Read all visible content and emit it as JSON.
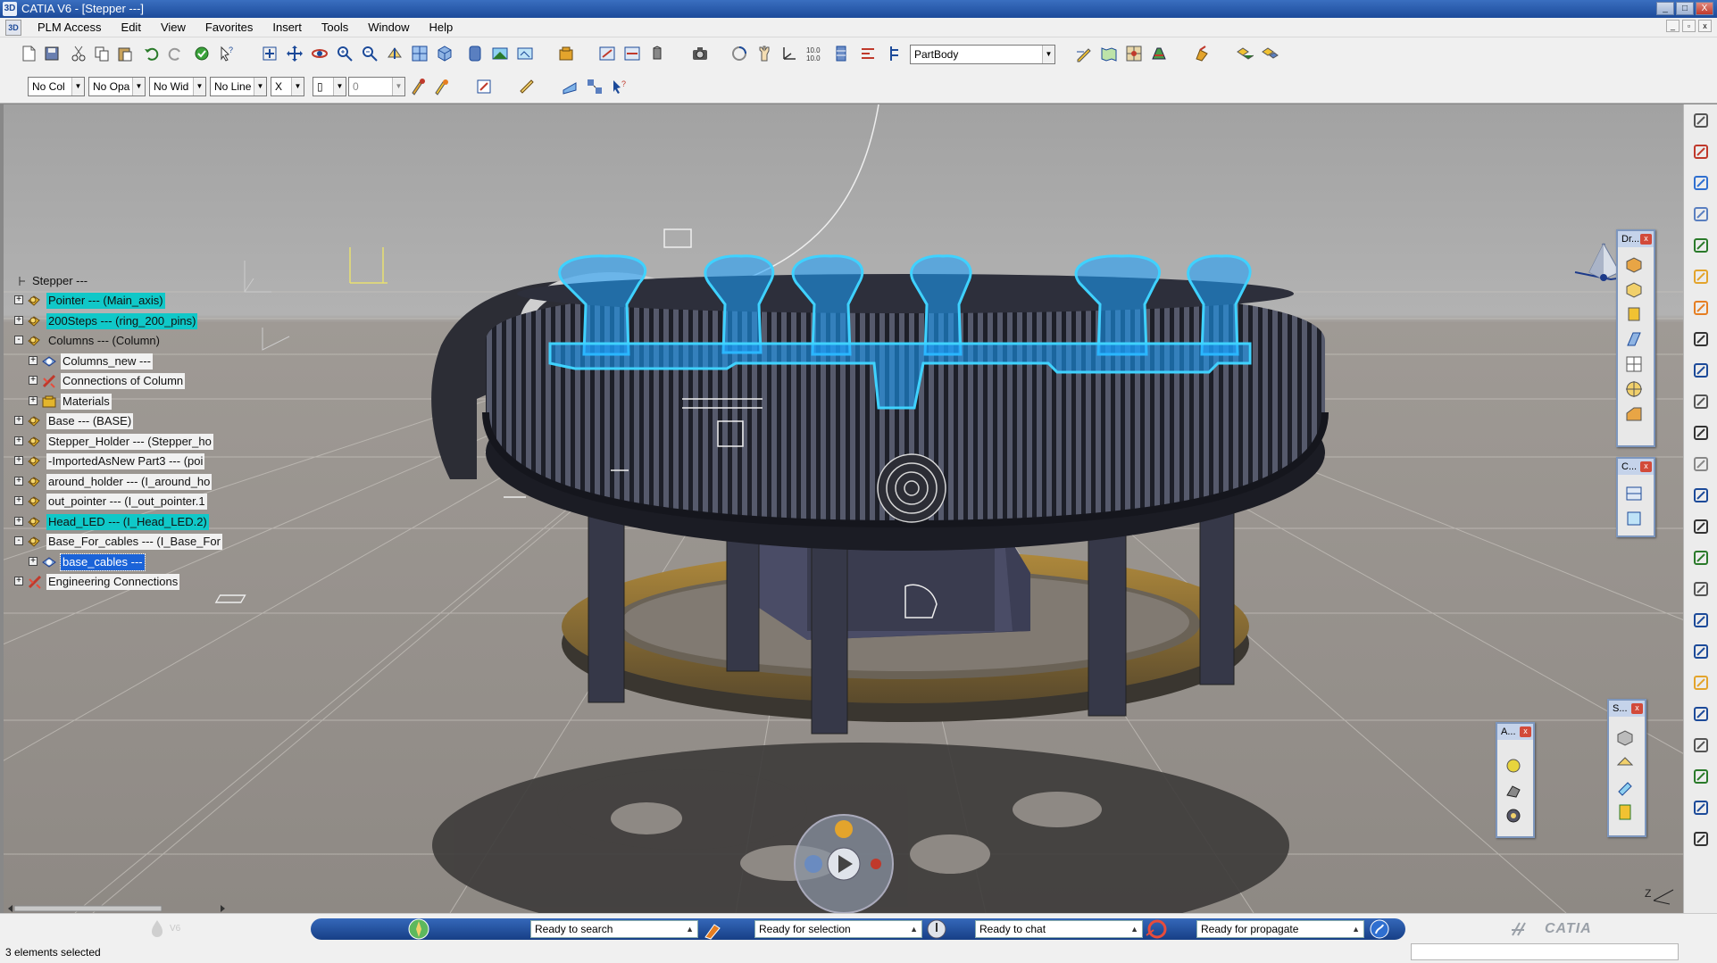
{
  "window": {
    "title": "CATIA V6 - [Stepper ---]",
    "buttons": [
      "_",
      "□",
      "X"
    ]
  },
  "menu": {
    "items": [
      "PLM Access",
      "Edit",
      "View",
      "Favorites",
      "Insert",
      "Tools",
      "Window",
      "Help"
    ]
  },
  "toolbar": {
    "body_select": "PartBody"
  },
  "graphic_props": {
    "color": "No Col",
    "opacity": "No Opa",
    "width": "No Wid",
    "line": "No Line",
    "point": "X",
    "layer_value": "0"
  },
  "tree": {
    "root": "Stepper ---",
    "nodes": [
      {
        "label": "Pointer --- (Main_axis)",
        "state": "highlight"
      },
      {
        "label": "200Steps --- (ring_200_pins)",
        "state": "highlight"
      },
      {
        "label": "Columns --- (Column)",
        "state": "plain"
      },
      {
        "label": "Columns_new ---",
        "state": "normal"
      },
      {
        "label": "Connections of Column",
        "state": "normal"
      },
      {
        "label": "Materials",
        "state": "normal"
      },
      {
        "label": "Base --- (BASE)",
        "state": "normal"
      },
      {
        "label": "Stepper_Holder --- (Stepper_ho",
        "state": "normal"
      },
      {
        "label": "-ImportedAsNew Part3 --- (poi",
        "state": "normal"
      },
      {
        "label": "around_holder --- (I_around_ho",
        "state": "normal"
      },
      {
        "label": "out_pointer --- (I_out_pointer.1",
        "state": "normal"
      },
      {
        "label": "Head_LED --- (I_Head_LED.2)",
        "state": "highlight"
      },
      {
        "label": "Base_For_cables --- (I_Base_For",
        "state": "normal"
      },
      {
        "label": "base_cables ---",
        "state": "selected"
      },
      {
        "label": "Engineering Connections",
        "state": "normal"
      }
    ]
  },
  "palettes": {
    "drafting": "Dr...",
    "c": "C...",
    "a": "A...",
    "s": "S..."
  },
  "status": {
    "search": "Ready to search",
    "selection": "Ready for selection",
    "chat": "Ready to chat",
    "propagate": "Ready for propagate",
    "selected_count": "3 elements selected",
    "v6": "V6",
    "brand": "CATIA"
  },
  "axis_label": "Z"
}
